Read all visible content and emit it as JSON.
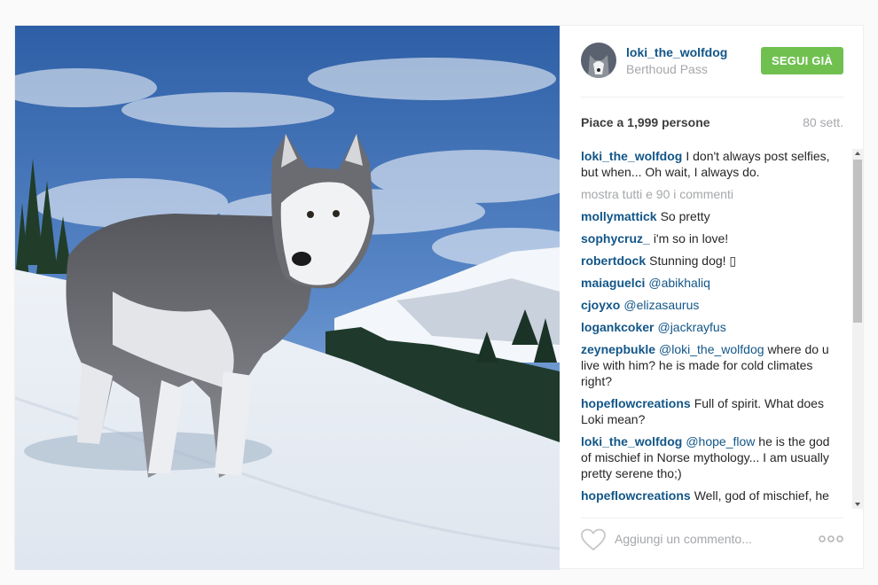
{
  "post": {
    "image": {
      "subject": "photo-husky-snow-mountain"
    },
    "author": {
      "username": "loki_the_wolfdog",
      "location": "Berthoud Pass"
    },
    "follow_label": "SEGUI GIÀ",
    "likes_text": "Piace a 1,999 persone",
    "time_text": "80 sett.",
    "caption": {
      "author": "loki_the_wolfdog",
      "text": "I don't always post selfies, but when... Oh wait, I always do."
    },
    "show_all_comments": "mostra tutti e 90 i commenti",
    "comments": [
      {
        "author": "mollymattick",
        "mention": "",
        "text": "So pretty"
      },
      {
        "author": "sophycruz_",
        "mention": "",
        "text": "i'm so in love!"
      },
      {
        "author": "robertdock",
        "mention": "",
        "text": "Stunning dog! ▯"
      },
      {
        "author": "maiaguelci",
        "mention": "@abikhaliq",
        "text": ""
      },
      {
        "author": "cjoyxo",
        "mention": "@elizasaurus",
        "text": ""
      },
      {
        "author": "logankcoker",
        "mention": "@jackrayfus",
        "text": ""
      },
      {
        "author": "zeynepbukle",
        "mention": "@loki_the_wolfdog",
        "text": "where do u live with him? he is made for cold climates right?"
      },
      {
        "author": "hopeflowcreations",
        "mention": "",
        "text": "Full of spirit. What does Loki mean?"
      },
      {
        "author": "loki_the_wolfdog",
        "mention": "@hope_flow",
        "text": "he is the god of mischief in Norse mythology... I am usually pretty serene tho;)"
      },
      {
        "author": "hopeflowcreations",
        "mention": "",
        "text": "Well, god of mischief, he sounds like a perfect name then!"
      }
    ],
    "comment_placeholder": "Aggiungi un commento...",
    "icons": {
      "like": "heart-outline-icon",
      "more": "three-dots-icon"
    },
    "colors": {
      "link": "#125688",
      "follow_button": "#70c050",
      "muted": "#a5a7aa"
    }
  }
}
